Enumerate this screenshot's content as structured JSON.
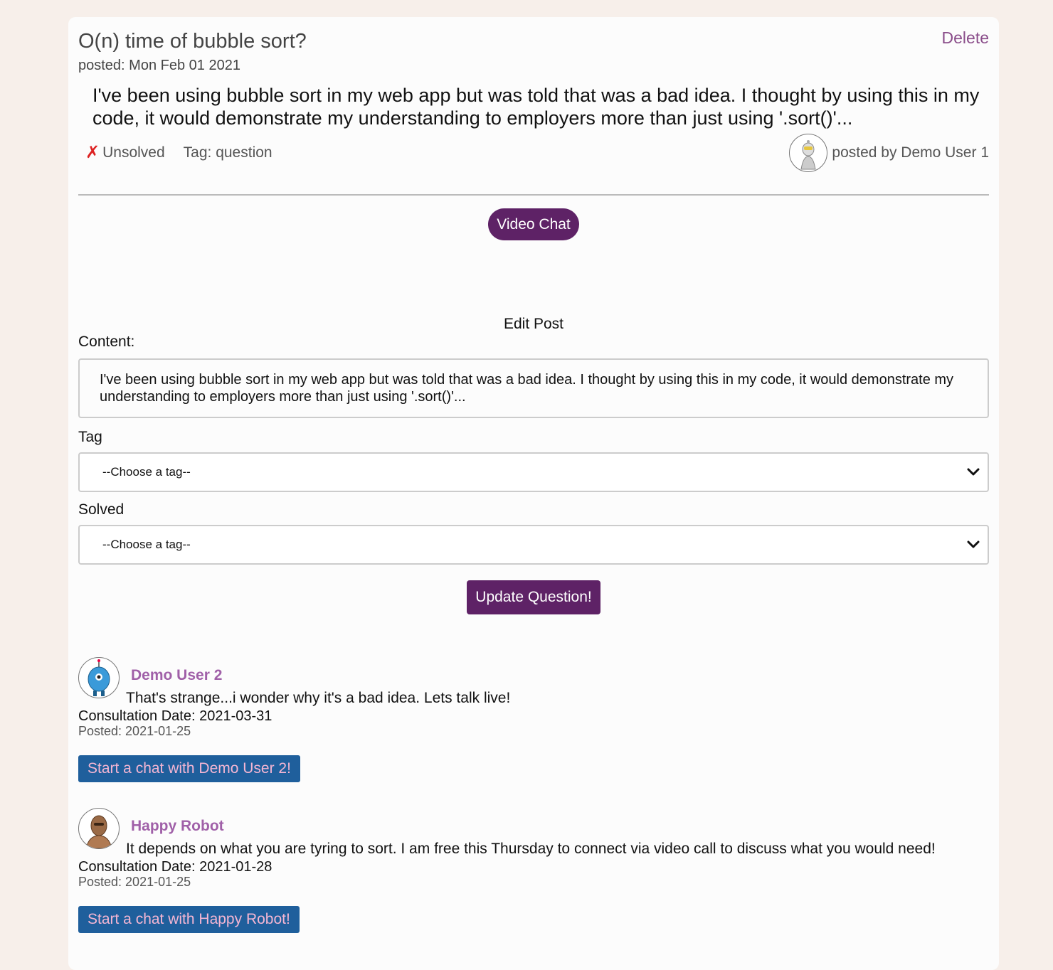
{
  "question": {
    "title": "O(n) time of bubble sort?",
    "delete_label": "Delete",
    "posted": "posted: Mon Feb 01 2021",
    "body": "I've been using bubble sort in my web app but was told that was a bad idea. I thought by using this in my code, it would demonstrate my understanding to employers more than just using '.sort()'...",
    "status_icon": "✗",
    "status": "Unsolved",
    "tag": "Tag: question",
    "posted_by": "posted by Demo User 1"
  },
  "video_chat_label": "Video Chat",
  "edit": {
    "heading": "Edit Post",
    "content_label": "Content:",
    "content_value": "I've been using bubble sort in my web app but was told that was a bad idea. I thought by using this in my code, it would demonstrate my understanding to employers more than just using '.sort()'...",
    "tag_label": "Tag",
    "tag_selected": "--Choose a tag--",
    "solved_label": "Solved",
    "solved_selected": "--Choose a tag--",
    "submit_label": "Update Question!"
  },
  "comments": [
    {
      "name": "Demo User 2",
      "text": "That's strange...i wonder why it's a bad idea. Lets talk live!",
      "consultation": "Consultation Date: 2021-03-31",
      "posted": "Posted: 2021-01-25",
      "chat_label": "Start a chat with Demo User 2!",
      "avatar_icon": "blue-robot-avatar"
    },
    {
      "name": "Happy Robot",
      "text": "It depends on what you are tyring to sort. I am free this Thursday to connect via video call to discuss what you would need!",
      "consultation": "Consultation Date: 2021-01-28",
      "posted": "Posted: 2021-01-25",
      "chat_label": "Start a chat with Happy Robot!",
      "avatar_icon": "brown-robot-avatar"
    }
  ],
  "colors": {
    "page_bg": "#f7efea",
    "primary_purple": "#5e2266",
    "name_purple": "#a060a8",
    "chat_blue": "#1f5f9c",
    "chat_text_pink": "#f5b6d3",
    "unsolved_red": "#dd2222"
  }
}
